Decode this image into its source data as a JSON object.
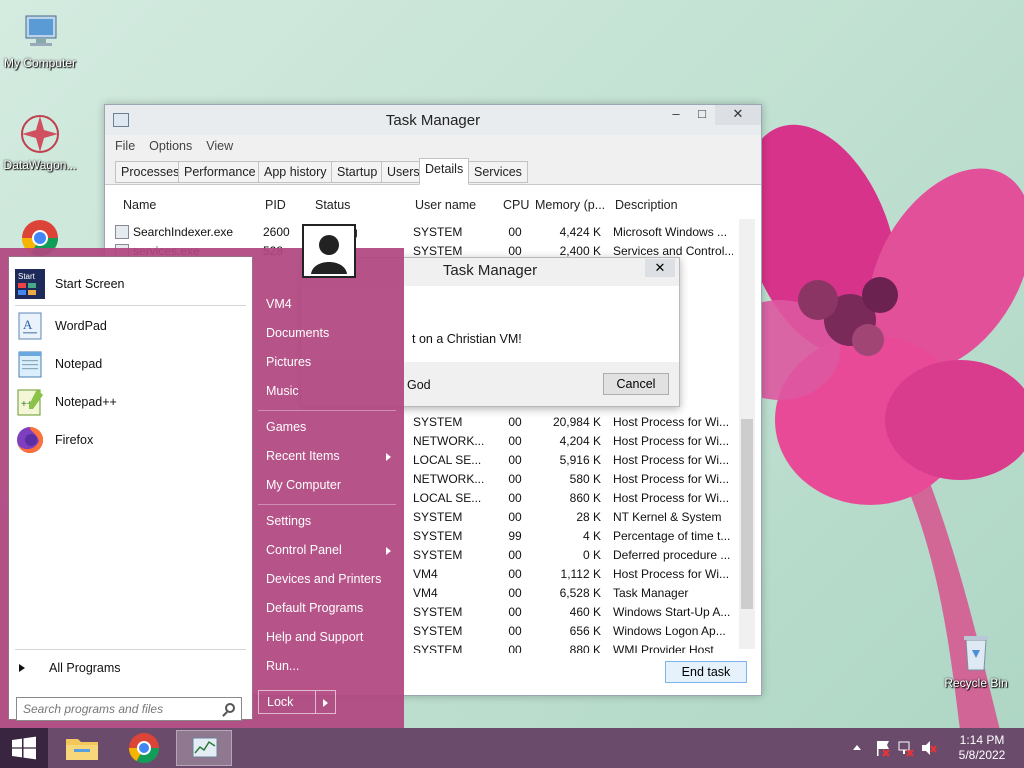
{
  "desktop": {
    "icons": [
      {
        "label": "My Computer",
        "icon": "computer-icon"
      },
      {
        "label": "DataWagon...",
        "icon": "datawagon-icon"
      },
      {
        "label": "Recycle Bin",
        "icon": "recycle-bin-icon"
      }
    ]
  },
  "task_manager": {
    "title": "Task Manager",
    "menu": [
      "File",
      "Options",
      "View"
    ],
    "tabs": [
      "Processes",
      "Performance",
      "App history",
      "Startup",
      "Users",
      "Details",
      "Services"
    ],
    "active_tab": "Details",
    "columns": [
      "Name",
      "PID",
      "Status",
      "User name",
      "CPU",
      "Memory (p...",
      "Description"
    ],
    "rows": [
      {
        "name": "SearchIndexer.exe",
        "pid": "2600",
        "status": "Running",
        "user": "SYSTEM",
        "cpu": "00",
        "mem": "4,424 K",
        "desc": "Microsoft Windows ..."
      },
      {
        "name": "services.exe",
        "pid": "528",
        "status": "",
        "user": "SYSTEM",
        "cpu": "00",
        "mem": "2,400 K",
        "desc": "Services and Control..."
      },
      {
        "name": "",
        "pid": "",
        "status": "",
        "user": "",
        "cpu": "",
        "mem": "",
        "desc": "tion M..."
      },
      {
        "name": "",
        "pid": "",
        "status": "",
        "user": "",
        "cpu": "",
        "mem": "",
        "desc": "ystem ..."
      },
      {
        "name": "",
        "pid": "",
        "status": "",
        "user": "",
        "cpu": "",
        "mem": "",
        "desc": "enu"
      },
      {
        "name": "",
        "pid": "",
        "status": "",
        "user": "",
        "cpu": "",
        "mem": "",
        "desc": "for Wi..."
      },
      {
        "name": "",
        "pid": "",
        "status": "",
        "user": "",
        "cpu": "",
        "mem": "",
        "desc": "for Wi..."
      },
      {
        "name": "",
        "pid": "",
        "status": "",
        "user": "",
        "cpu": "",
        "mem": "",
        "desc": "for Wi..."
      },
      {
        "name": "",
        "pid": "",
        "status": "",
        "user": "",
        "cpu": "",
        "mem": "",
        "desc": "for Wi..."
      },
      {
        "name": "",
        "pid": "",
        "status": "",
        "user": "",
        "cpu": "",
        "mem": "",
        "desc": "for Wi..."
      },
      {
        "name": "",
        "pid": "",
        "status": "",
        "user": "SYSTEM",
        "cpu": "00",
        "mem": "20,984 K",
        "desc": "Host Process for Wi..."
      },
      {
        "name": "",
        "pid": "",
        "status": "",
        "user": "NETWORK...",
        "cpu": "00",
        "mem": "4,204 K",
        "desc": "Host Process for Wi..."
      },
      {
        "name": "",
        "pid": "",
        "status": "",
        "user": "LOCAL SE...",
        "cpu": "00",
        "mem": "5,916 K",
        "desc": "Host Process for Wi..."
      },
      {
        "name": "",
        "pid": "",
        "status": "",
        "user": "NETWORK...",
        "cpu": "00",
        "mem": "580 K",
        "desc": "Host Process for Wi..."
      },
      {
        "name": "",
        "pid": "",
        "status": "",
        "user": "LOCAL SE...",
        "cpu": "00",
        "mem": "860 K",
        "desc": "Host Process for Wi..."
      },
      {
        "name": "",
        "pid": "",
        "status": "",
        "user": "SYSTEM",
        "cpu": "00",
        "mem": "28 K",
        "desc": "NT Kernel & System"
      },
      {
        "name": "",
        "pid": "",
        "status": "",
        "user": "SYSTEM",
        "cpu": "99",
        "mem": "4 K",
        "desc": "Percentage of time t..."
      },
      {
        "name": "",
        "pid": "",
        "status": "",
        "user": "SYSTEM",
        "cpu": "00",
        "mem": "0 K",
        "desc": "Deferred procedure ..."
      },
      {
        "name": "",
        "pid": "",
        "status": "",
        "user": "VM4",
        "cpu": "00",
        "mem": "1,112 K",
        "desc": "Host Process for Wi..."
      },
      {
        "name": "",
        "pid": "",
        "status": "",
        "user": "VM4",
        "cpu": "00",
        "mem": "6,528 K",
        "desc": "Task Manager"
      },
      {
        "name": "",
        "pid": "",
        "status": "",
        "user": "SYSTEM",
        "cpu": "00",
        "mem": "460 K",
        "desc": "Windows Start-Up A..."
      },
      {
        "name": "",
        "pid": "",
        "status": "",
        "user": "SYSTEM",
        "cpu": "00",
        "mem": "656 K",
        "desc": "Windows Logon Ap..."
      },
      {
        "name": "",
        "pid": "",
        "status": "",
        "user": "SYSTEM",
        "cpu": "00",
        "mem": "880 K",
        "desc": "WMI Provider Host"
      }
    ],
    "end_task_label": "End task"
  },
  "dialog": {
    "title": "Task Manager",
    "message": "t on a Christian VM!",
    "footer": "God",
    "cancel_label": "Cancel"
  },
  "start_menu": {
    "pinned": [
      {
        "label": "Start Screen",
        "icon": "start-screen-icon"
      },
      {
        "label": "WordPad",
        "icon": "wordpad-icon"
      },
      {
        "label": "Notepad",
        "icon": "notepad-icon"
      },
      {
        "label": "Notepad++",
        "icon": "notepadpp-icon"
      },
      {
        "label": "Firefox",
        "icon": "firefox-icon"
      }
    ],
    "all_programs": "All Programs",
    "search_placeholder": "Search programs and files",
    "right_items": [
      {
        "label": "VM4",
        "submenu": false
      },
      {
        "label": "Documents",
        "submenu": false
      },
      {
        "label": "Pictures",
        "submenu": false
      },
      {
        "label": "Music",
        "submenu": false
      },
      {
        "label": "Games",
        "submenu": false
      },
      {
        "label": "Recent Items",
        "submenu": true
      },
      {
        "label": "My Computer",
        "submenu": false
      },
      {
        "label": "Settings",
        "submenu": false
      },
      {
        "label": "Control Panel",
        "submenu": true
      },
      {
        "label": "Devices and Printers",
        "submenu": false
      },
      {
        "label": "Default Programs",
        "submenu": false
      },
      {
        "label": "Help and Support",
        "submenu": false
      },
      {
        "label": "Run...",
        "submenu": false
      }
    ],
    "lock_label": "Lock"
  },
  "taskbar": {
    "apps": [
      {
        "name": "file-explorer",
        "icon": "folder-icon",
        "active": false
      },
      {
        "name": "chrome",
        "icon": "chrome-icon",
        "active": false
      },
      {
        "name": "task-manager",
        "icon": "task-manager-icon",
        "active": true
      }
    ],
    "time": "1:14 PM",
    "date": "5/8/2022"
  },
  "colors": {
    "start_menu_bg": "#b04680",
    "taskbar_bg": "#6a4b6b",
    "wallpaper": "#c3e2d3",
    "flower": "#e0458f"
  }
}
